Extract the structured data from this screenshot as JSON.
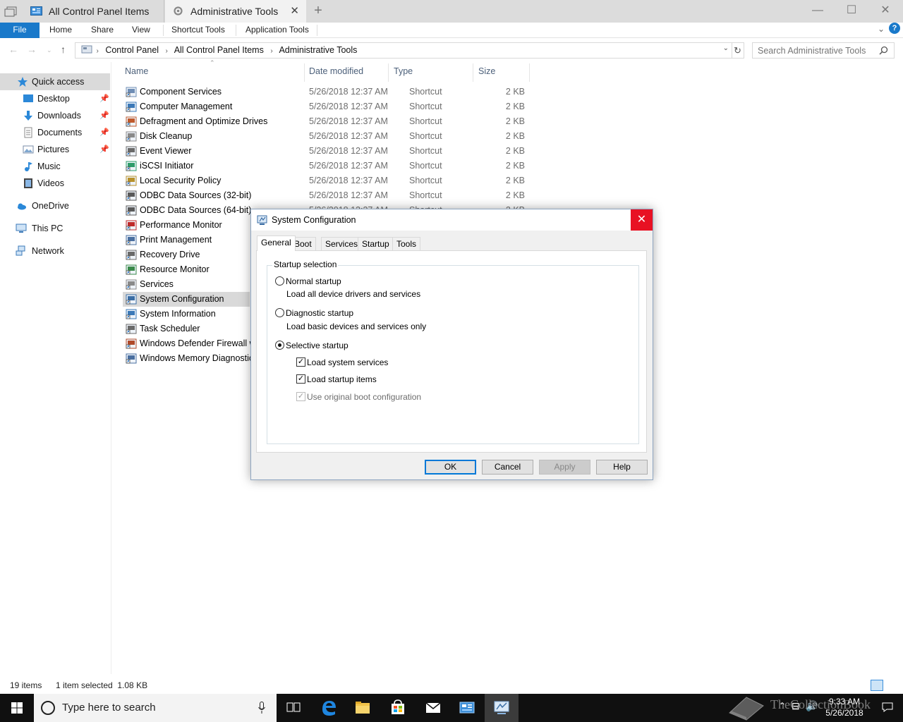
{
  "tabs": [
    {
      "label": "All Control Panel Items"
    },
    {
      "label": "Administrative Tools"
    }
  ],
  "ribbon": {
    "file": "File",
    "home": "Home",
    "share": "Share",
    "view": "View",
    "shortcut_tools": "Shortcut Tools",
    "application_tools": "Application Tools",
    "help": "?"
  },
  "address": {
    "crumbs": [
      "Control Panel",
      "All Control Panel Items",
      "Administrative Tools"
    ],
    "search_placeholder": "Search Administrative Tools"
  },
  "sidebar": {
    "items": [
      {
        "label": "Quick access",
        "icon": "star-icon",
        "pinned": false
      },
      {
        "label": "Desktop",
        "icon": "desktop-icon",
        "pinned": true
      },
      {
        "label": "Downloads",
        "icon": "download-icon",
        "pinned": true
      },
      {
        "label": "Documents",
        "icon": "document-icon",
        "pinned": true
      },
      {
        "label": "Pictures",
        "icon": "picture-icon",
        "pinned": true
      },
      {
        "label": "Music",
        "icon": "music-icon",
        "pinned": false
      },
      {
        "label": "Videos",
        "icon": "video-icon",
        "pinned": false
      },
      {
        "label": "OneDrive",
        "icon": "cloud-icon",
        "pinned": false
      },
      {
        "label": "This PC",
        "icon": "computer-icon",
        "pinned": false
      },
      {
        "label": "Network",
        "icon": "network-icon",
        "pinned": false
      }
    ]
  },
  "columns": {
    "name": "Name",
    "date": "Date modified",
    "type": "Type",
    "size": "Size"
  },
  "files": [
    {
      "name": "Component Services",
      "date": "5/26/2018 12:37 AM",
      "type": "Shortcut",
      "size": "2 KB"
    },
    {
      "name": "Computer Management",
      "date": "5/26/2018 12:37 AM",
      "type": "Shortcut",
      "size": "2 KB"
    },
    {
      "name": "Defragment and Optimize Drives",
      "date": "5/26/2018 12:37 AM",
      "type": "Shortcut",
      "size": "2 KB"
    },
    {
      "name": "Disk Cleanup",
      "date": "5/26/2018 12:37 AM",
      "type": "Shortcut",
      "size": "2 KB"
    },
    {
      "name": "Event Viewer",
      "date": "5/26/2018 12:37 AM",
      "type": "Shortcut",
      "size": "2 KB"
    },
    {
      "name": "iSCSI Initiator",
      "date": "5/26/2018 12:37 AM",
      "type": "Shortcut",
      "size": "2 KB"
    },
    {
      "name": "Local Security Policy",
      "date": "5/26/2018 12:37 AM",
      "type": "Shortcut",
      "size": "2 KB"
    },
    {
      "name": "ODBC Data Sources (32-bit)",
      "date": "5/26/2018 12:37 AM",
      "type": "Shortcut",
      "size": "2 KB"
    },
    {
      "name": "ODBC Data Sources (64-bit)",
      "date": "5/26/2018 12:37 AM",
      "type": "Shortcut",
      "size": "2 KB"
    },
    {
      "name": "Performance Monitor",
      "date": "",
      "type": "",
      "size": ""
    },
    {
      "name": "Print Management",
      "date": "",
      "type": "",
      "size": ""
    },
    {
      "name": "Recovery Drive",
      "date": "",
      "type": "",
      "size": ""
    },
    {
      "name": "Resource Monitor",
      "date": "",
      "type": "",
      "size": ""
    },
    {
      "name": "Services",
      "date": "",
      "type": "",
      "size": ""
    },
    {
      "name": "System Configuration",
      "date": "",
      "type": "",
      "size": "",
      "selected": true
    },
    {
      "name": "System Information",
      "date": "",
      "type": "",
      "size": ""
    },
    {
      "name": "Task Scheduler",
      "date": "",
      "type": "",
      "size": ""
    },
    {
      "name": "Windows Defender Firewall wi",
      "date": "",
      "type": "",
      "size": ""
    },
    {
      "name": "Windows Memory Diagnostic",
      "date": "",
      "type": "",
      "size": ""
    }
  ],
  "status": {
    "count": "19 items",
    "selection": "1 item selected  1.08 KB"
  },
  "dialog": {
    "title": "System Configuration",
    "close": "✕",
    "tabs": [
      "General",
      "Boot",
      "Services",
      "Startup",
      "Tools"
    ],
    "group": "Startup selection",
    "normal": "Normal startup",
    "normal_desc": "Load all device drivers and services",
    "diagnostic": "Diagnostic startup",
    "diagnostic_desc": "Load basic devices and services only",
    "selective": "Selective startup",
    "load_system": "Load system services",
    "load_startup": "Load startup items",
    "use_original": "Use original boot configuration",
    "buttons": {
      "ok": "OK",
      "cancel": "Cancel",
      "apply": "Apply",
      "help": "Help"
    }
  },
  "taskbar": {
    "search": "Type here to search",
    "time": "9:33 AM",
    "date": "5/26/2018"
  },
  "watermark": "TheCollectionBook",
  "colors": {
    "accent": "#1979ca",
    "close_red": "#e81123",
    "selection": "#d9d9d9",
    "taskbar": "#101010"
  }
}
